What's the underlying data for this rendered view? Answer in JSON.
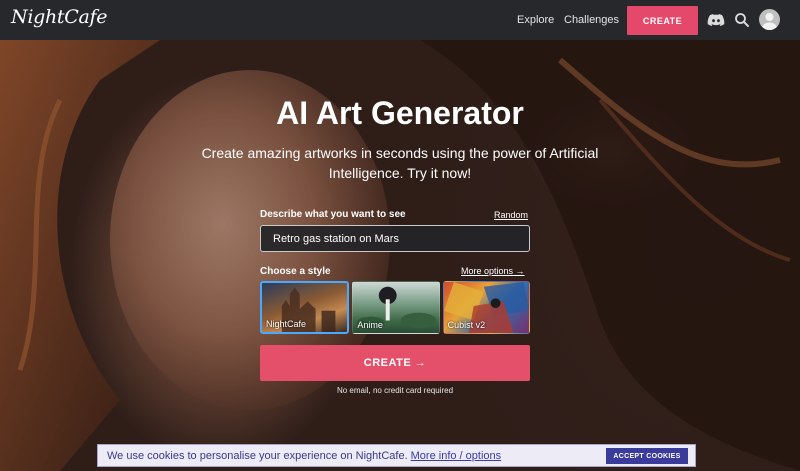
{
  "nav": {
    "logo": "NightCafe",
    "explore": "Explore",
    "challenges": "Challenges",
    "create": "CREATE"
  },
  "hero": {
    "title": "AI Art Generator",
    "subtitle": "Create amazing artworks in seconds using the power of Artificial Intelligence. Try it now!",
    "prompt_label": "Describe what you want to see",
    "random": "Random",
    "prompt_value": "Retro gas station on Mars",
    "style_label": "Choose a style",
    "more_options": "More options →",
    "styles": [
      {
        "label": "NightCafe",
        "selected": true
      },
      {
        "label": "Anime",
        "selected": false
      },
      {
        "label": "Cubist v2",
        "selected": false
      }
    ],
    "create_button": "CREATE →",
    "note": "No email, no credit card required"
  },
  "cookie": {
    "text": "We use cookies to personalise your experience on NightCafe.",
    "link": "More info / options",
    "accept": "ACCEPT COOKIES"
  },
  "colors": {
    "accent": "#e4486a",
    "nav_bg": "#26282c",
    "cookie_button": "#3b3b9c"
  }
}
